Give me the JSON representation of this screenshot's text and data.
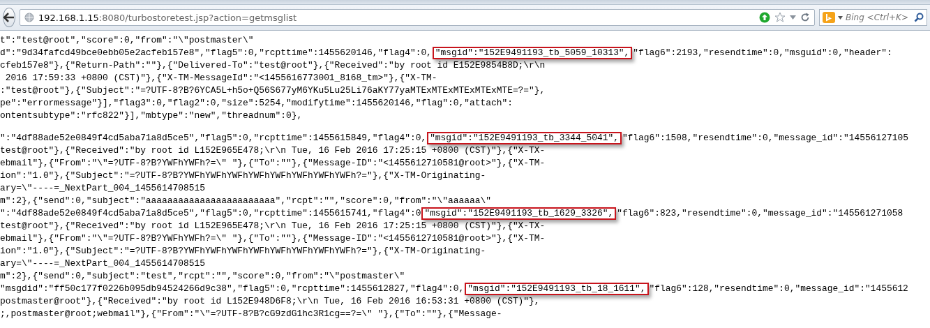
{
  "address_bar": {
    "host": "192.168.1.15",
    "path": ":8080/turbostoretest.jsp?action=getmsglist"
  },
  "search": {
    "placeholder": "Bing <Ctrl+K>"
  },
  "blocks": [
    {
      "lines": [
        {
          "segments": [
            {
              "text": "t\":\"test@root\",\"score\":0,\"from\":\"\\\"postmaster\\\"",
              "highlighted": false
            }
          ]
        },
        {
          "segments": [
            {
              "text": "d\":\"9d34fafcd49bce0ebb05e2acfeb157e8\",\"flag5\":0,\"rcpttime\":1455620146,\"flag4\":0,",
              "highlighted": false
            },
            {
              "text": "\"msgid\":\"152E9491193_tb_5059_10313\",",
              "highlighted": true
            },
            {
              "text": "\"flag6\":2193,\"resendtime\":0,\"msguid\":0,\"header\":",
              "highlighted": false
            }
          ]
        },
        {
          "segments": [
            {
              "text": "cfeb157e8\"},{\"Return-Path\":\"\"},{\"Delivered-To\":\"test@root\"},{\"Received\":\"by root id E152E9854B8D;\\r\\n",
              "highlighted": false
            }
          ]
        },
        {
          "segments": [
            {
              "text": " 2016 17:59:33 +0800 (CST)\"},{\"X-TM-MessageId\":\"<1455616773001_8168_tm>\"},{\"X-TM-",
              "highlighted": false
            }
          ]
        },
        {
          "segments": [
            {
              "text": ":\"test@root\"},{\"Subject\":\"=?UTF-8?B?6YCA5L+h5o+Q56S677yM6YKu5Lu25Li76aKY77yaMTExMTExMTExMTExMTE=?=\"},",
              "highlighted": false
            }
          ]
        },
        {
          "segments": [
            {
              "text": "pe\":\"errormessage\"}],\"flag3\":0,\"flag2\":0,\"size\":5254,\"modifytime\":1455620146,\"flag\":0,\"attach\":",
              "highlighted": false
            }
          ]
        },
        {
          "segments": [
            {
              "text": "ontentsubtype\":\"rfc822\"}],\"mbtype\":\"new\",\"threadnum\":0},",
              "highlighted": false
            }
          ]
        }
      ]
    },
    {
      "lines": [
        {
          "segments": [
            {
              "text": "\":\"4df88ade52e0849f4cd5aba71a8d5ce5\",\"flag5\":0,\"rcpttime\":1455615849,\"flag4\":0,",
              "highlighted": false
            },
            {
              "text": "\"msgid\":\"152E9491193_tb_3344_5041\",",
              "highlighted": true
            },
            {
              "text": "\"flag6\":1508,\"resendtime\":0,\"message_id\":\"14556127105",
              "highlighted": false
            }
          ]
        },
        {
          "segments": [
            {
              "text": "test@root\"},{\"Received\":\"by root id L152E965E478;\\r\\n Tue, 16 Feb 2016 17:25:15 +0800 (CST)\"},{\"X-TX-",
              "highlighted": false
            }
          ]
        },
        {
          "segments": [
            {
              "text": "ebmail\"},{\"From\":\"\\\"=?UTF-8?B?YWFhYWFh?=\\\" \"},{\"To\":\"\"},{\"Message-ID\":\"<1455612710581@root>\"},{\"X-TM-",
              "highlighted": false
            }
          ]
        },
        {
          "segments": [
            {
              "text": "ion\":\"1.0\"},{\"Subject\":\"=?UTF-8?B?YWFhYWFhYWFhYWFhYWFhYWFhYWFhYWFh?=\"},{\"X-TM-Originating-",
              "highlighted": false
            }
          ]
        },
        {
          "segments": [
            {
              "text": "ary=\\\"----=_NextPart_004_1455614708515",
              "highlighted": false
            }
          ]
        },
        {
          "segments": [
            {
              "text": "m\":2},{\"send\":0,\"subject\":\"aaaaaaaaaaaaaaaaaaaaaaaa\",\"rcpt\":\"\",\"score\":0,\"from\":\"\\\"aaaaaa\\\"",
              "highlighted": false
            }
          ]
        },
        {
          "segments": [
            {
              "text": "\":\"4df88ade52e0849f4cd5aba71a8d5ce5\",\"flag5\":0,\"rcpttime\":1455615741,\"flag4\":0",
              "highlighted": false
            },
            {
              "text": "\"msgid\":\"152E9491193_tb_1629_3326\",",
              "highlighted": true
            },
            {
              "text": "\"flag6\":823,\"resendtime\":0,\"message_id\":\"145561271058",
              "highlighted": false
            }
          ]
        },
        {
          "segments": [
            {
              "text": "test@root\"},{\"Received\":\"by root id L152E965E478;\\r\\n Tue, 16 Feb 2016 17:25:15 +0800 (CST)\"},{\"X-TX-",
              "highlighted": false
            }
          ]
        },
        {
          "segments": [
            {
              "text": "ebmail\"},{\"From\":\"\\\"=?UTF-8?B?YWFhYWFh?=\\\" \"},{\"To\":\"\"},{\"Message-ID\":\"<1455612710581@root>\"},{\"X-TM-",
              "highlighted": false
            }
          ]
        },
        {
          "segments": [
            {
              "text": "ion\":\"1.0\"},{\"Subject\":\"=?UTF-8?B?YWFhYWFhYWFhYWFhYWFhYWFhYWFhYWFh?=\"},{\"X-TM-Originating-",
              "highlighted": false
            }
          ]
        },
        {
          "segments": [
            {
              "text": "ary=\\\"----=_NextPart_004_1455614708515",
              "highlighted": false
            }
          ]
        },
        {
          "segments": [
            {
              "text": "m\":2},{\"send\":0,\"subject\":\"test\",\"rcpt\":\"\",\"score\":0,\"from\":\"\\\"postmaster\\\"",
              "highlighted": false
            }
          ]
        },
        {
          "segments": [
            {
              "text": "\"msgdid\":\"ff50c177f0226b095db94524266d9c38\",\"flag5\":0,\"rcpttime\":1455612827,\"flag4\":0,",
              "highlighted": false
            },
            {
              "text": "\"msgid\":\"152E9491193_tb_18_1611\",",
              "highlighted": true
            },
            {
              "text": "\"flag6\":128,\"resendtime\":0,\"message_id\":\"1455612",
              "highlighted": false
            }
          ]
        },
        {
          "segments": [
            {
              "text": "postmaster@root\"},{\"Received\":\"by root id L152E948D6F8;\\r\\n Tue, 16 Feb 2016 16:53:31 +0800 (CST)\"},",
              "highlighted": false
            }
          ]
        },
        {
          "segments": [
            {
              "text": ";,postmaster@root;webmail\"},{\"From\":\"\\\"=?UTF-8?B?cG9zdG1hc3R1cg==?=\\\" \"},{\"To\":\"\"},{\"Message-",
              "highlighted": false
            }
          ]
        }
      ]
    }
  ]
}
